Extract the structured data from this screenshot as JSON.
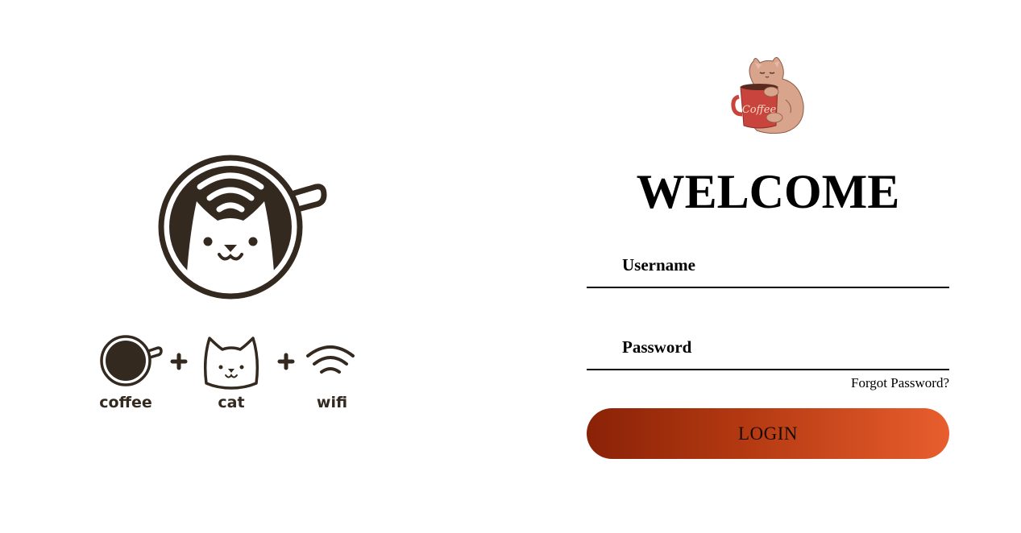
{
  "welcome": {
    "title": "WELCOME"
  },
  "form": {
    "username_placeholder": "Username",
    "password_placeholder": "Password",
    "forgot_label": "Forgot Password?",
    "login_label": "LOGIN"
  },
  "illustration": {
    "logo_icon": "coffee-cat-wifi-cup-icon",
    "items": [
      {
        "label": "coffee",
        "icon": "coffee-cup-icon"
      },
      {
        "label": "cat",
        "icon": "cat-face-icon"
      },
      {
        "label": "wifi",
        "icon": "wifi-icon"
      }
    ],
    "mascot_mug_text": "Coffee",
    "mascot_icon": "cat-hugging-mug-icon"
  },
  "colors": {
    "ink": "#33291f",
    "button_start": "#8a2207",
    "button_end": "#e85e2e",
    "mug_red": "#c8443c",
    "cat_fur": "#d9a48c"
  }
}
